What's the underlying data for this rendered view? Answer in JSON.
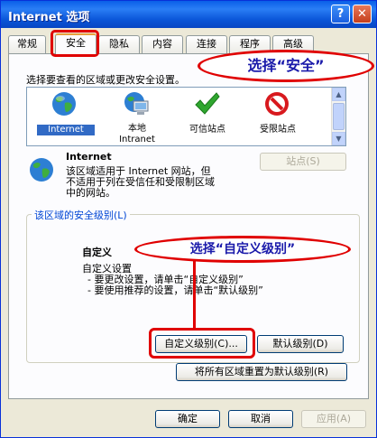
{
  "window": {
    "title": "Internet 选项",
    "help_symbol": "?",
    "close_symbol": "✕"
  },
  "tabs": [
    {
      "label": "常规"
    },
    {
      "label": "安全"
    },
    {
      "label": "隐私"
    },
    {
      "label": "内容"
    },
    {
      "label": "连接"
    },
    {
      "label": "程序"
    },
    {
      "label": "高级"
    }
  ],
  "active_tab": "安全",
  "zones_prompt": "选择要查看的区域或更改安全设置。",
  "zones": [
    {
      "label": "Internet",
      "icon": "globe-icon",
      "selected": true
    },
    {
      "label_line1": "本地",
      "label_line2": "Intranet",
      "icon": "computer-icon"
    },
    {
      "label": "可信站点",
      "icon": "checkmark-icon"
    },
    {
      "label": "受限站点",
      "icon": "no-entry-icon"
    }
  ],
  "zone_info": {
    "name": "Internet",
    "desc_line1": "该区域适用于 Internet 网站，但",
    "desc_line2": "不适用于列在受信任和受限制区域",
    "desc_line3": "中的网站。"
  },
  "sites_button": "站点(S)",
  "security_level": {
    "legend": "该区域的安全级别(L)",
    "level_name": "自定义",
    "line1": "自定义设置",
    "line2": "- 要更改设置，请单击“自定义级别”",
    "line3": "- 要使用推荐的设置，请单击“默认级别”"
  },
  "buttons": {
    "custom_level": "自定义级别(C)...",
    "default_level": "默认级别(D)",
    "reset_all": "将所有区域重置为默认级别(R)",
    "ok": "确定",
    "cancel": "取消",
    "apply": "应用(A)"
  },
  "annotations": {
    "select_security": "选择“安全”",
    "select_custom_level": "选择“自定义级别”"
  },
  "colors": {
    "accent": "#0a5fe8",
    "annotation": "#e00000",
    "selection": "#316ac5"
  }
}
